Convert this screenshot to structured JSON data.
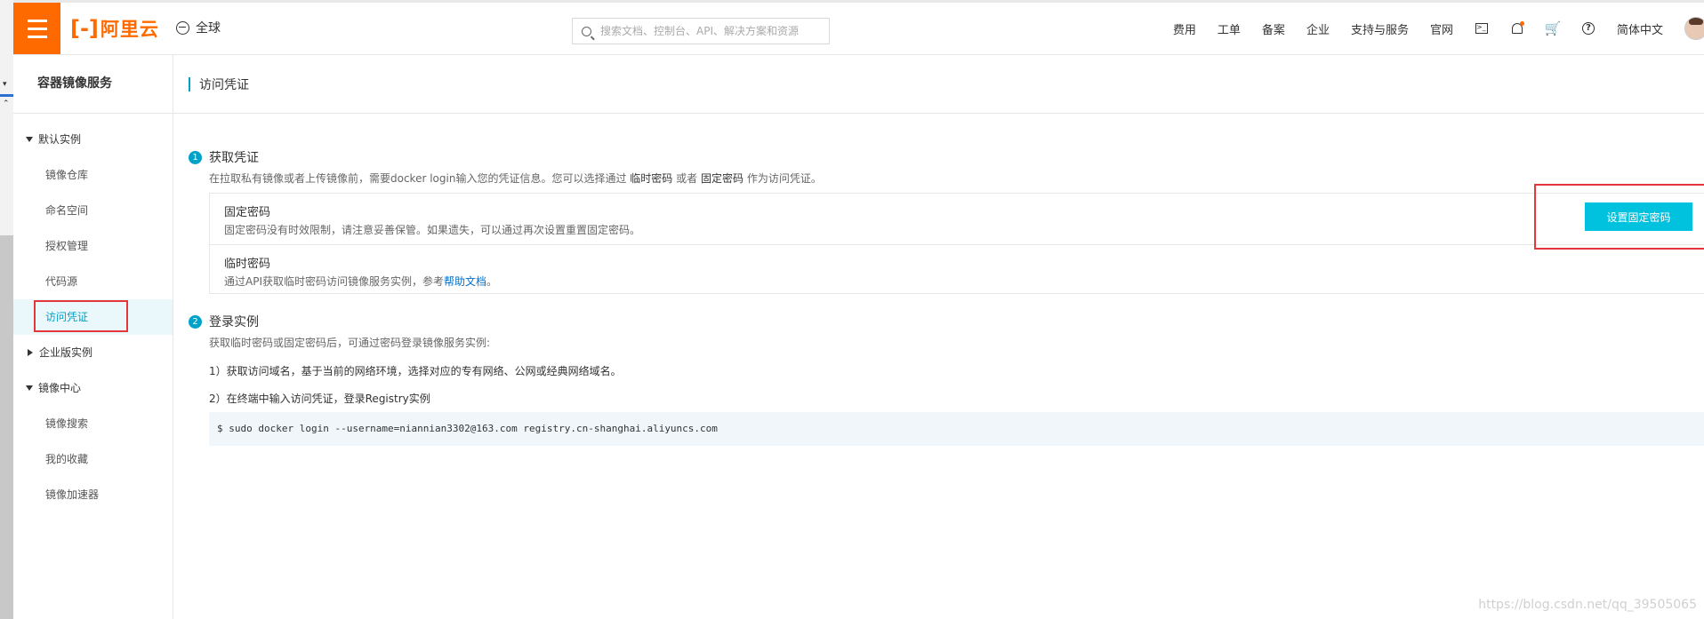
{
  "topbar": {
    "brand": "阿里云",
    "region": "全球",
    "search_placeholder": "搜索文档、控制台、API、解决方案和资源",
    "nav": [
      "费用",
      "工单",
      "备案",
      "企业",
      "支持与服务",
      "官网"
    ],
    "language": "简体中文",
    "icons": [
      "terminal-icon",
      "bell-icon",
      "cart-icon",
      "help-icon"
    ]
  },
  "sidebar": {
    "title": "容器镜像服务",
    "groups": [
      {
        "label": "默认实例",
        "expanded": true,
        "items": [
          "镜像仓库",
          "命名空间",
          "授权管理",
          "代码源",
          "访问凭证"
        ]
      },
      {
        "label": "企业版实例",
        "expanded": false,
        "items": []
      },
      {
        "label": "镜像中心",
        "expanded": true,
        "items": [
          "镜像搜索",
          "我的收藏",
          "镜像加速器"
        ]
      }
    ],
    "active_item": "访问凭证"
  },
  "main": {
    "page_title": "访问凭证",
    "step1": {
      "num": "1",
      "title": "获取凭证",
      "desc_pre": "在拉取私有镜像或者上传镜像前，需要docker login输入您的凭证信息。您可以选择通过",
      "desc_temp": "临时密码",
      "desc_or": "或者",
      "desc_fixed": "固定密码",
      "desc_post": "作为访问凭证。",
      "fixed": {
        "title": "固定密码",
        "desc": "固定密码没有时效限制，请注意妥善保管。如果遗失，可以通过再次设置重置固定密码。",
        "button": "设置固定密码"
      },
      "temp": {
        "title": "临时密码",
        "desc_pre": "通过API获取临时密码访问镜像服务实例，参考",
        "link": "帮助文档",
        "desc_post": "。"
      }
    },
    "step2": {
      "num": "2",
      "title": "登录实例",
      "desc": "获取临时密码或固定密码后，可通过密码登录镜像服务实例:",
      "line1": "1）获取访问域名，基于当前的网络环境，选择对应的专有网络、公网或经典网络域名。",
      "line2": "2）在终端中输入访问凭证，登录Registry实例",
      "command": "$ sudo docker login --username=niannian3302@163.com registry.cn-shanghai.aliyuncs.com"
    }
  },
  "watermark": "https://blog.csdn.net/qq_39505065",
  "colors": {
    "brand": "#ff6a00",
    "accent": "#00c1de",
    "highlight": "#e5363d"
  }
}
